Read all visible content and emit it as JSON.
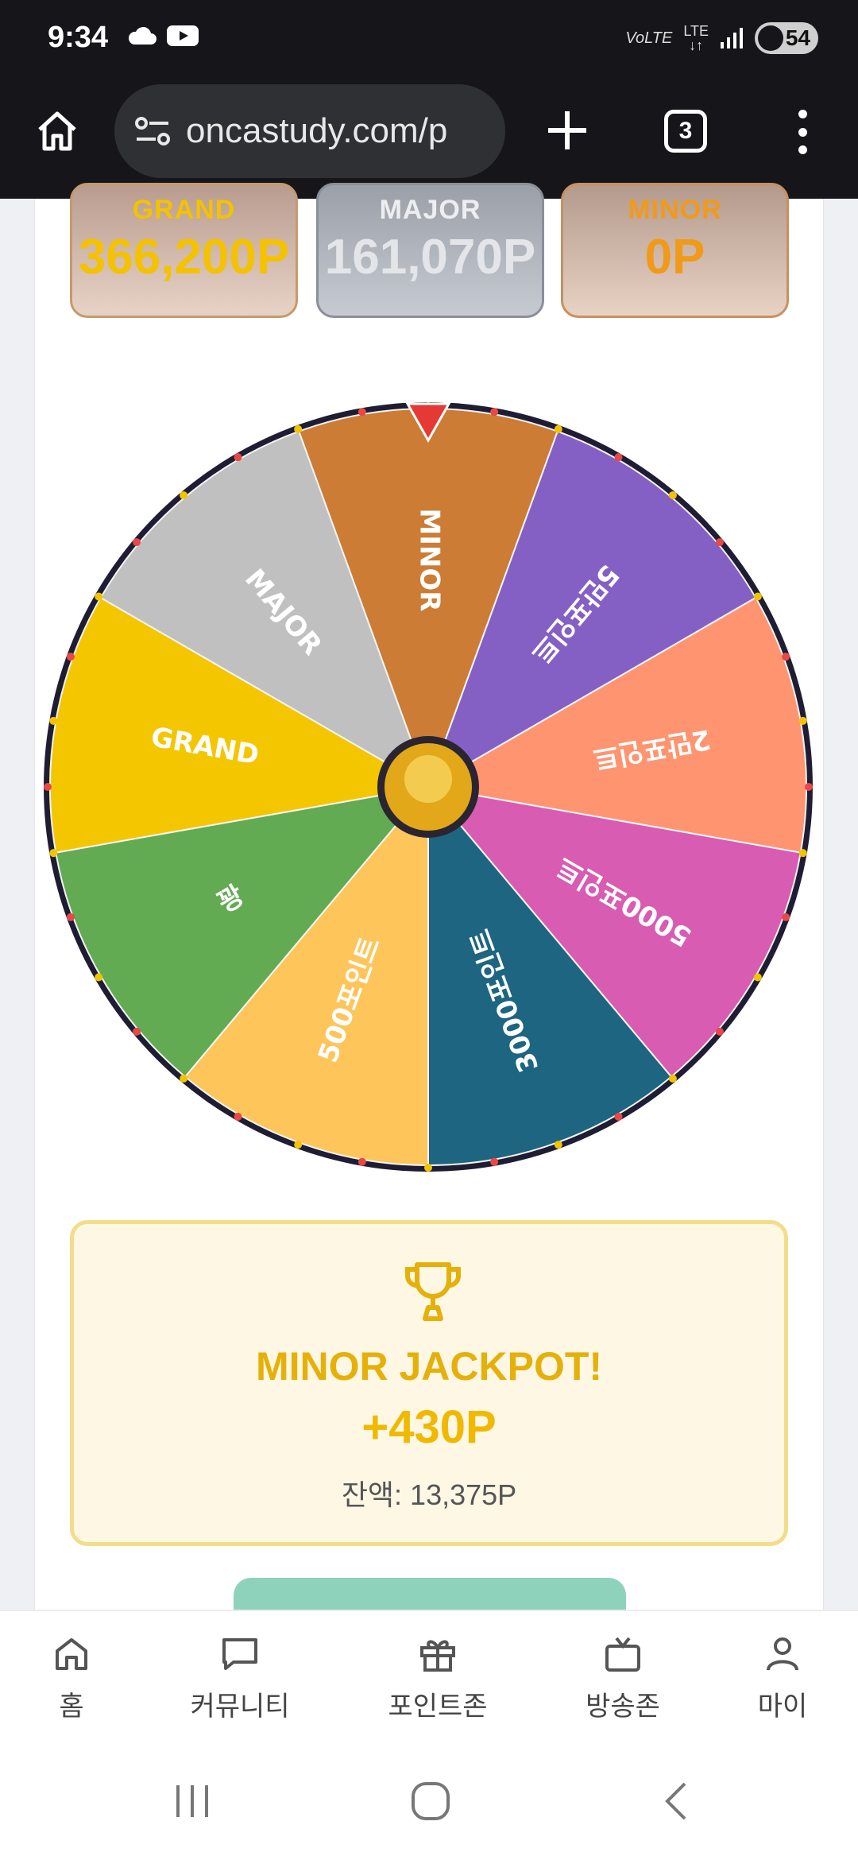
{
  "status_bar": {
    "time": "9:34",
    "network_volte": "VoLTE",
    "network_lte": "LTE",
    "battery_level": "54"
  },
  "browser": {
    "url": "oncastudy.com/p",
    "tab_count": "3"
  },
  "jackpots": {
    "grand": {
      "label": "GRAND",
      "value": "366,200P"
    },
    "major": {
      "label": "MAJOR",
      "value": "161,070P"
    },
    "minor": {
      "label": "MINOR",
      "value": "0P"
    }
  },
  "wheel": {
    "segments": [
      {
        "label": "MINOR",
        "color": "#cc7c34"
      },
      {
        "label": "5만포인트",
        "color": "#8560c4"
      },
      {
        "label": "2만포인트",
        "color": "#ff9570"
      },
      {
        "label": "5000포인트",
        "color": "#d85cb1"
      },
      {
        "label": "3000포인트",
        "color": "#1d6580"
      },
      {
        "label": "500포인트",
        "color": "#fec55b"
      },
      {
        "label": "꽝",
        "color": "#62ab52"
      },
      {
        "label": "GRAND",
        "color": "#f4c600"
      },
      {
        "label": "MAJOR",
        "color": "#c0c0c0"
      }
    ],
    "pointer_color": "#e53935",
    "rim_color": "#1f1d33"
  },
  "result": {
    "title": "MINOR JACKPOT!",
    "points": "+430P",
    "balance": "잔액: 13,375P"
  },
  "bottom_nav": {
    "items": [
      {
        "label": "홈",
        "icon": "home-icon"
      },
      {
        "label": "커뮤니티",
        "icon": "chat-icon"
      },
      {
        "label": "포인트존",
        "icon": "gift-icon"
      },
      {
        "label": "방송존",
        "icon": "tv-icon"
      },
      {
        "label": "마이",
        "icon": "user-icon"
      }
    ]
  },
  "colors": {
    "grand": "#f4c200",
    "major": "#e3e5e9",
    "minor": "#f19a1a",
    "accent_gold": "#e6b00a"
  }
}
